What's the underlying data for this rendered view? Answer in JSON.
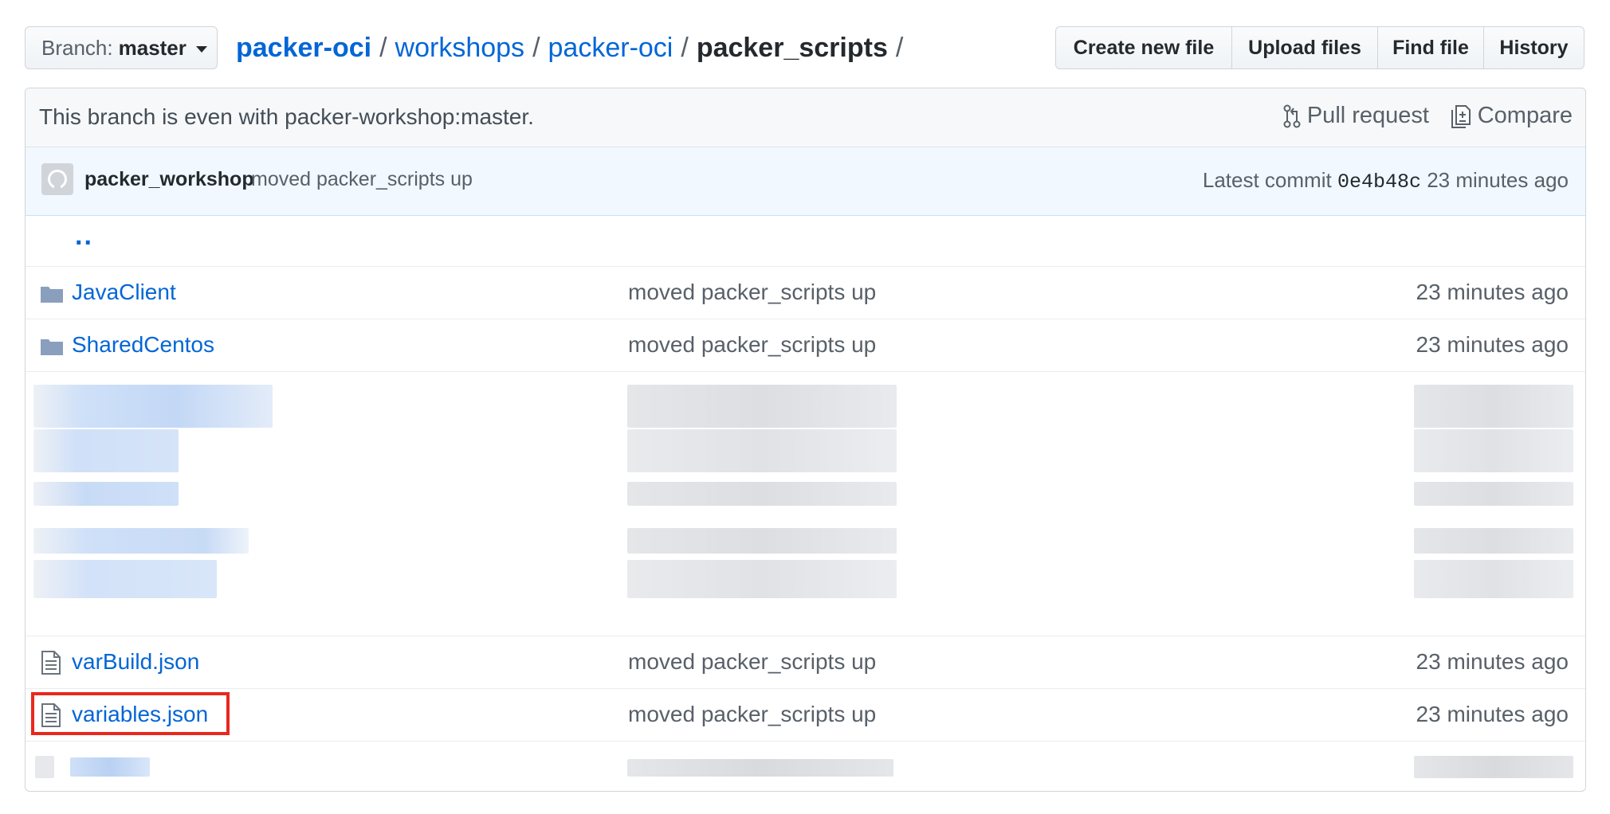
{
  "branch": {
    "label": "Branch:",
    "name": "master"
  },
  "breadcrumb": {
    "root": "packer-oci",
    "parts": [
      "workshops",
      "packer-oci"
    ],
    "current": "packer_scripts",
    "separator": "/"
  },
  "actions": [
    "Create new file",
    "Upload files",
    "Find file",
    "History"
  ],
  "compare_bar": {
    "text": "This branch is even with packer-workshop:master.",
    "pull_request": "Pull request",
    "compare": "Compare"
  },
  "commit": {
    "author": "packer_workshop",
    "message": "moved packer_scripts up",
    "latest_label": "Latest commit",
    "sha": "0e4b48c",
    "age": "23 minutes ago"
  },
  "parent_link": "..",
  "files": [
    {
      "name": "JavaClient",
      "type": "folder",
      "message": "moved packer_scripts up",
      "age": "23 minutes ago"
    },
    {
      "name": "SharedCentos",
      "type": "folder",
      "message": "moved packer_scripts up",
      "age": "23 minutes ago"
    },
    {
      "name": "varBuild.json",
      "type": "file",
      "message": "moved packer_scripts up",
      "age": "23 minutes ago"
    },
    {
      "name": "variables.json",
      "type": "file",
      "message": "moved packer_scripts up",
      "age": "23 minutes ago",
      "highlighted": true
    }
  ],
  "colors": {
    "link": "#0366d6",
    "highlight": "#e8281e",
    "commit_bg": "#f1f8ff"
  }
}
